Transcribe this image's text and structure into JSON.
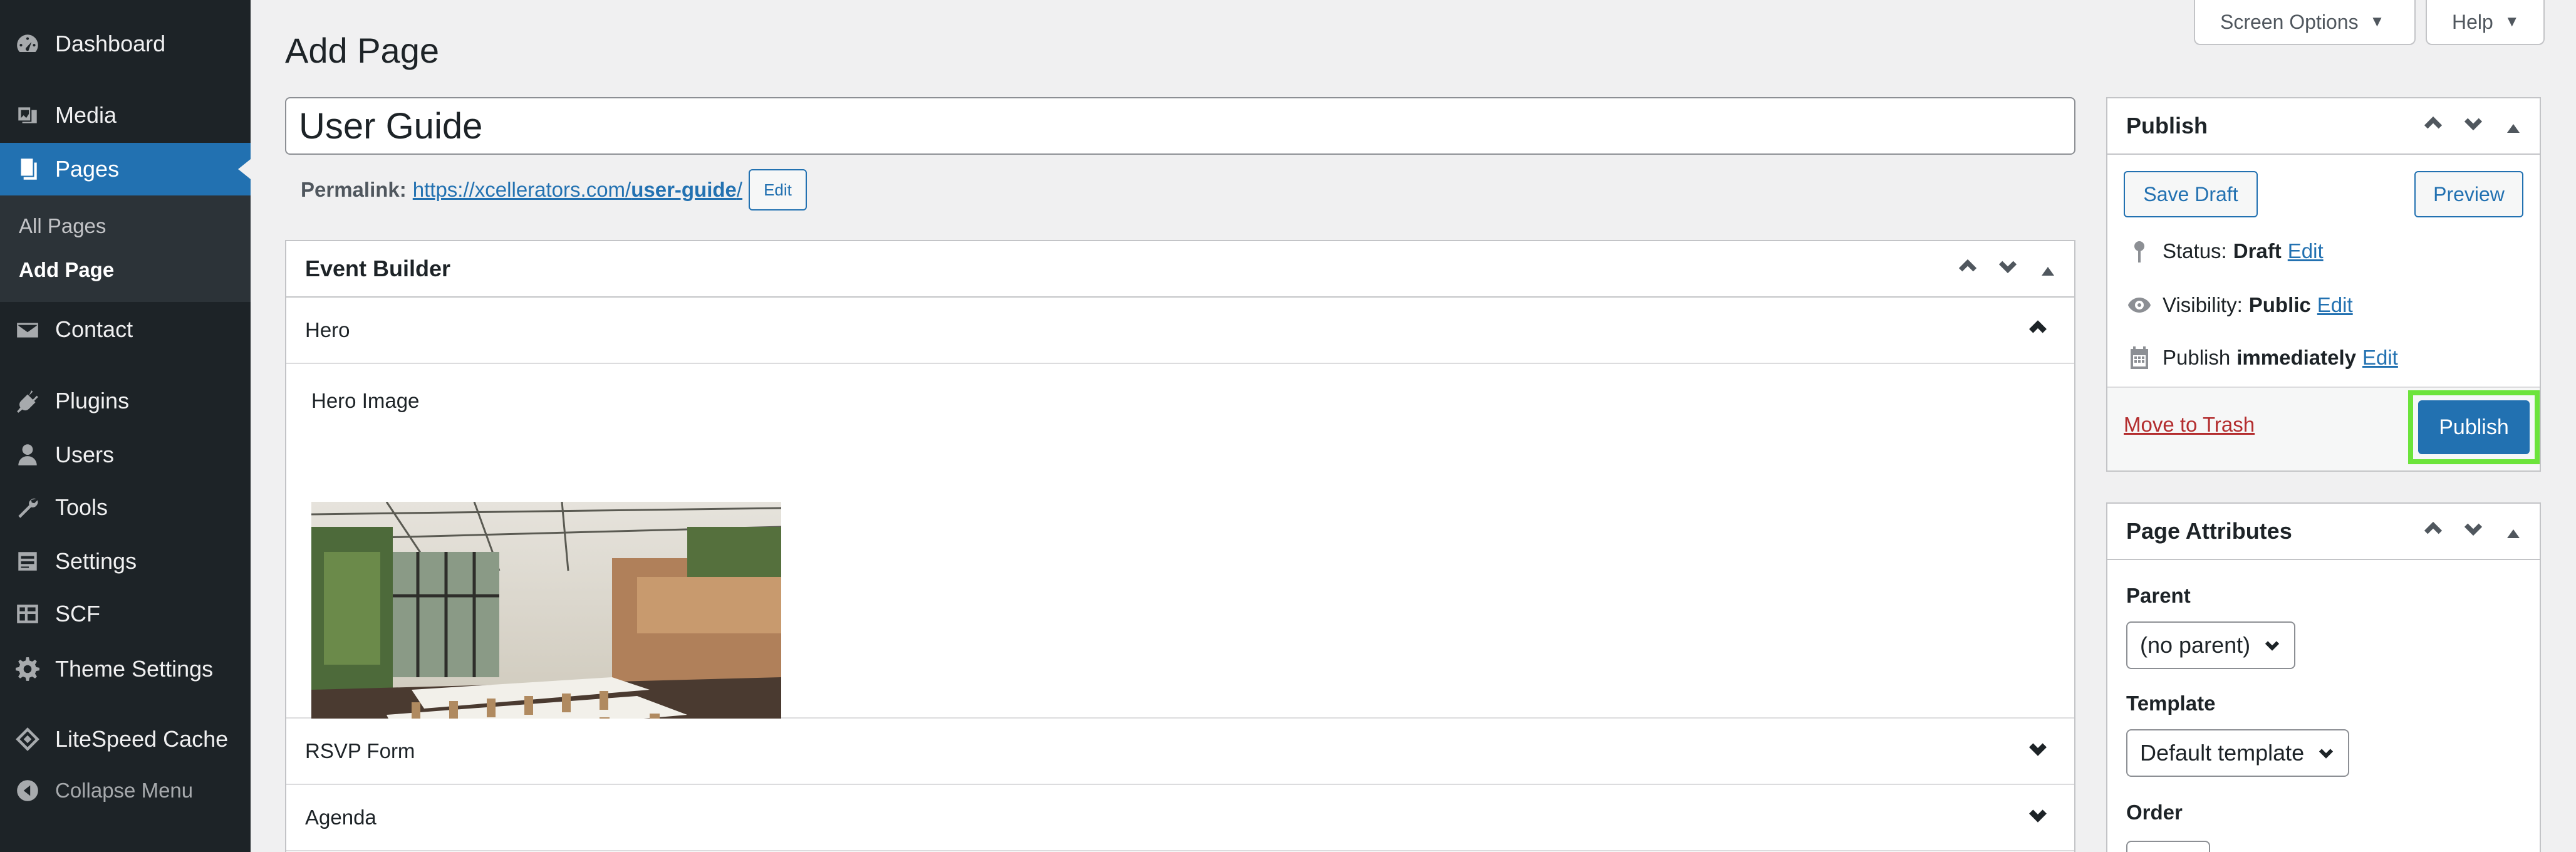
{
  "sidebar": {
    "items": [
      {
        "label": "Dashboard",
        "icon": "dashboard-icon"
      },
      {
        "label": "Media",
        "icon": "media-icon"
      },
      {
        "label": "Pages",
        "icon": "pages-icon"
      },
      {
        "label": "Contact",
        "icon": "envelope-icon"
      },
      {
        "label": "Plugins",
        "icon": "plugin-icon"
      },
      {
        "label": "Users",
        "icon": "users-icon"
      },
      {
        "label": "Tools",
        "icon": "wrench-icon"
      },
      {
        "label": "Settings",
        "icon": "settings-sliders-icon"
      },
      {
        "label": "SCF",
        "icon": "table-icon"
      },
      {
        "label": "Theme Settings",
        "icon": "gear-icon"
      },
      {
        "label": "LiteSpeed Cache",
        "icon": "diamond-icon"
      }
    ],
    "submenu": {
      "all_pages": "All Pages",
      "add_page": "Add Page"
    },
    "collapse": "Collapse Menu"
  },
  "topbar": {
    "screen_options": "Screen Options",
    "help": "Help"
  },
  "page": {
    "heading": "Add Page",
    "title_value": "User Guide",
    "permalink_label": "Permalink:",
    "permalink_base": "https://xcellerators.com/",
    "permalink_slug": "user-guide",
    "permalink_trailing": "/",
    "permalink_edit": "Edit"
  },
  "event_builder": {
    "title": "Event Builder",
    "sections": {
      "hero": "Hero",
      "rsvp": "RSVP Form",
      "agenda": "Agenda"
    },
    "hero_image_label": "Hero Image"
  },
  "publish": {
    "title": "Publish",
    "save_draft": "Save Draft",
    "preview": "Preview",
    "status_label": "Status:",
    "status_value": "Draft",
    "visibility_label": "Visibility:",
    "visibility_value": "Public",
    "schedule_label": "Publish",
    "schedule_value": "immediately",
    "edit": "Edit",
    "move_to_trash": "Move to Trash",
    "publish_button": "Publish"
  },
  "page_attributes": {
    "title": "Page Attributes",
    "parent_label": "Parent",
    "parent_value": "(no parent)",
    "template_label": "Template",
    "template_value": "Default template",
    "order_label": "Order"
  },
  "colors": {
    "sidebar": "#1d2327",
    "accent": "#2271b1",
    "highlight": "#6ce43b",
    "trash": "#b32d2e"
  }
}
